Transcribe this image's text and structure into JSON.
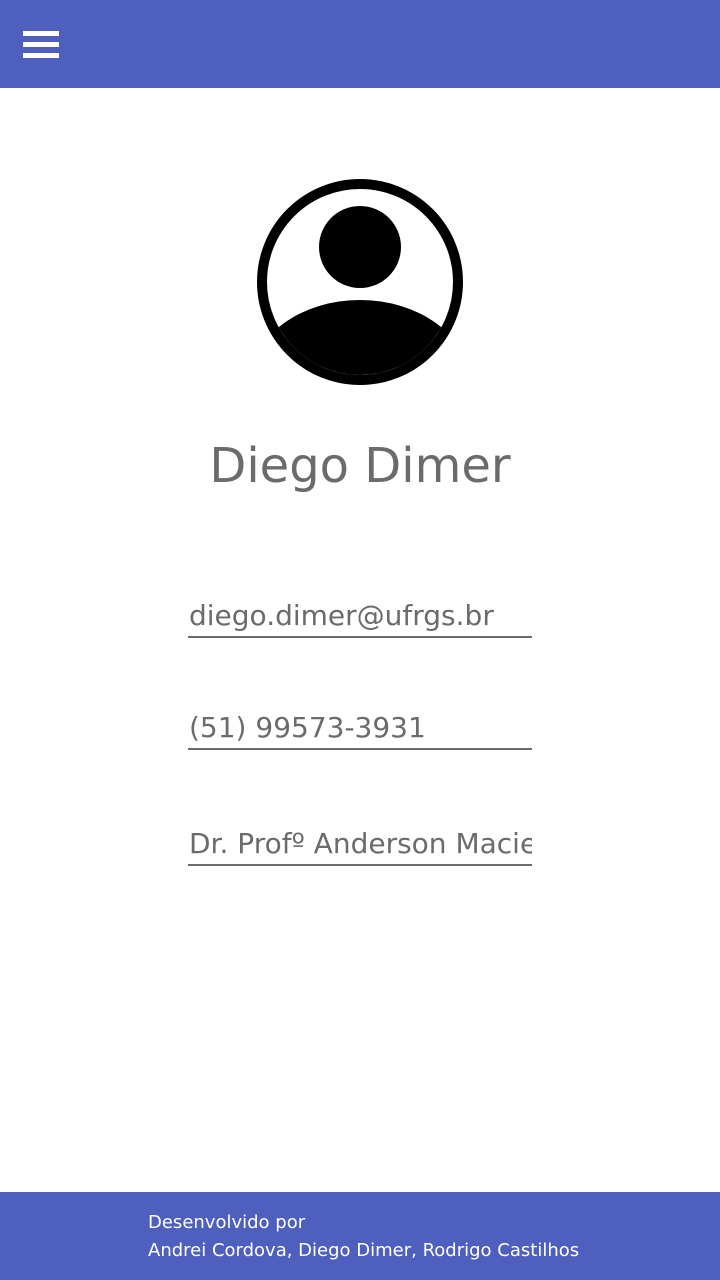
{
  "header": {
    "menu_icon": "hamburger-menu-icon",
    "background_color": "#4e5fbd"
  },
  "profile": {
    "avatar_icon": "account-circle-icon",
    "name": "Diego Dimer",
    "email": "diego.dimer@ufrgs.br",
    "phone": "(51) 99573-3931",
    "advisor": "Dr. Profº Anderson Maciel"
  },
  "footer": {
    "line1": "Desenvolvido por",
    "line2": "Andrei Cordova, Diego Dimer, Rodrigo Castilhos",
    "background_color": "#4e5fbd"
  }
}
